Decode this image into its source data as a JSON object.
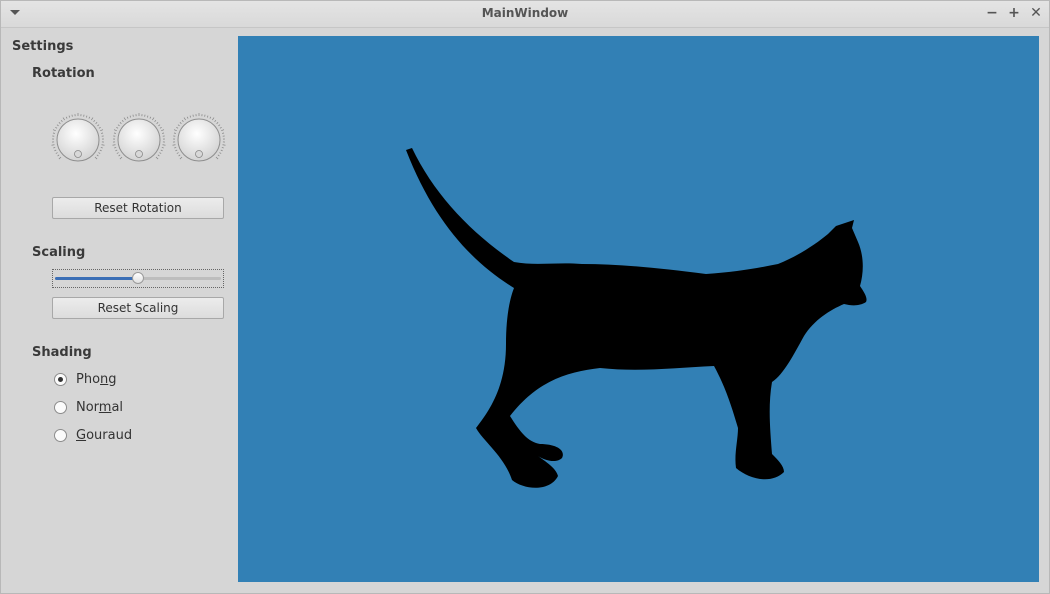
{
  "window": {
    "title": "MainWindow",
    "minimize_label": "−",
    "maximize_label": "+",
    "close_label": "✕"
  },
  "settings": {
    "heading": "Settings",
    "rotation": {
      "heading": "Rotation",
      "dials": [
        "rotation-x",
        "rotation-y",
        "rotation-z"
      ],
      "reset_label": "Reset Rotation"
    },
    "scaling": {
      "heading": "Scaling",
      "slider_value": 0.5,
      "reset_label": "Reset Scaling"
    },
    "shading": {
      "heading": "Shading",
      "options": [
        {
          "pre": "Pho",
          "u": "n",
          "post": "g",
          "checked": true
        },
        {
          "pre": "Nor",
          "u": "m",
          "post": "al",
          "checked": false
        },
        {
          "pre": "",
          "u": "G",
          "post": "ouraud",
          "checked": false
        }
      ]
    }
  },
  "viewport": {
    "background": "#3280b5",
    "model": "cat-silhouette",
    "model_color": "#000000"
  }
}
